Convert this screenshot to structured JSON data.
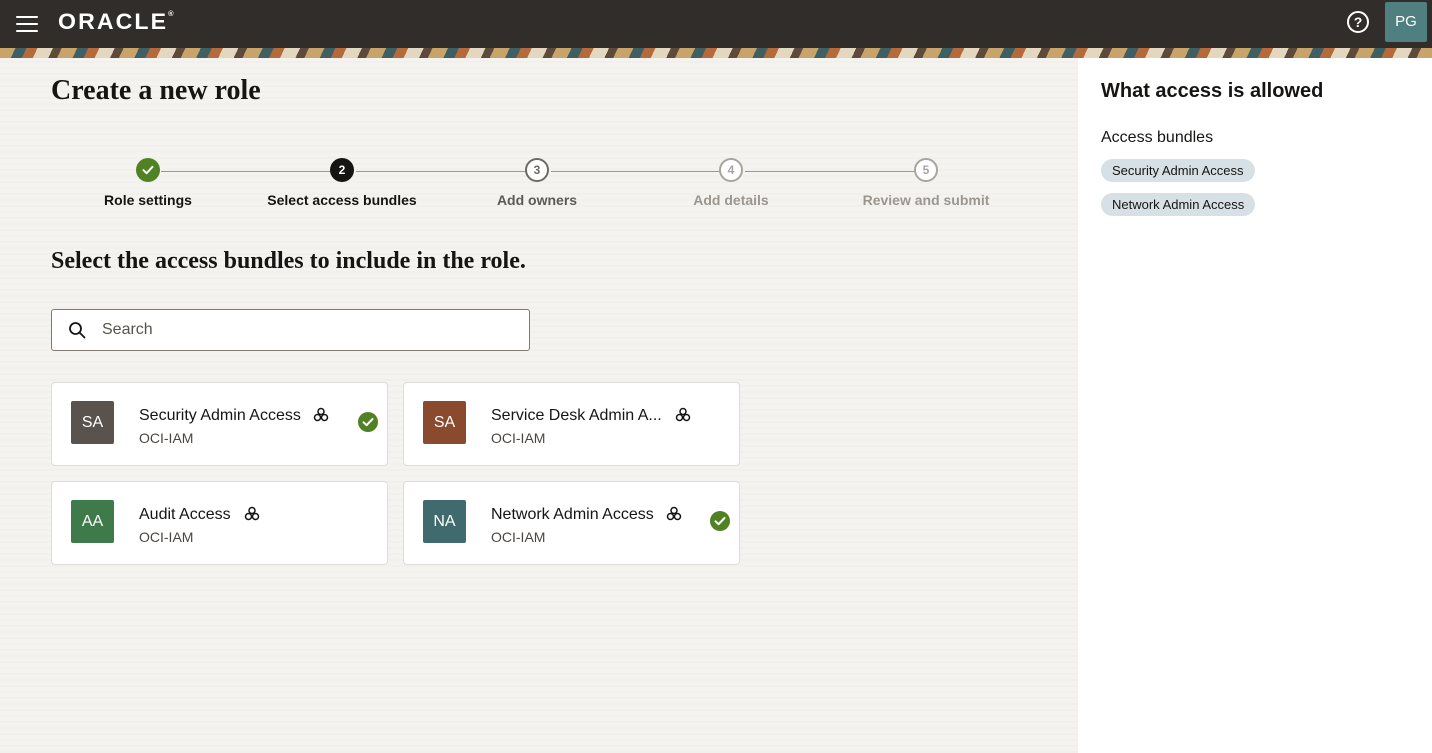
{
  "header": {
    "logo_text": "ORACLE",
    "logo_mark": "®",
    "help_icon": "question-circle-icon",
    "user_initials": "PG"
  },
  "page": {
    "title": "Create a new role",
    "instruction": "Select the access bundles to include in the role."
  },
  "stepper": {
    "steps": [
      {
        "number": "1",
        "label": "Role settings",
        "state": "done"
      },
      {
        "number": "2",
        "label": "Select access bundles",
        "state": "current"
      },
      {
        "number": "3",
        "label": "Add owners",
        "state": "next"
      },
      {
        "number": "4",
        "label": "Add details",
        "state": "later"
      },
      {
        "number": "5",
        "label": "Review and submit",
        "state": "later"
      }
    ]
  },
  "search": {
    "placeholder": "Search",
    "value": ""
  },
  "bundles": [
    {
      "initials": "SA",
      "name": "Security Admin Access",
      "source": "OCI-IAM",
      "selected": true,
      "avatar_color": "#5a534d"
    },
    {
      "initials": "SA",
      "name": "Service Desk Admin A...",
      "source": "OCI-IAM",
      "selected": false,
      "avatar_color": "#8a4a2d"
    },
    {
      "initials": "AA",
      "name": "Audit Access",
      "source": "OCI-IAM",
      "selected": false,
      "avatar_color": "#3f7a4a"
    },
    {
      "initials": "NA",
      "name": "Network Admin Access",
      "source": "OCI-IAM",
      "selected": true,
      "avatar_color": "#3f6b6e"
    }
  ],
  "side_panel": {
    "title": "What access is allowed",
    "subtitle": "Access bundles",
    "chips": [
      "Security Admin Access",
      "Network Admin Access"
    ]
  },
  "colors": {
    "topbar": "#312d2a",
    "success": "#508223",
    "chip": "#d7e1e5"
  }
}
